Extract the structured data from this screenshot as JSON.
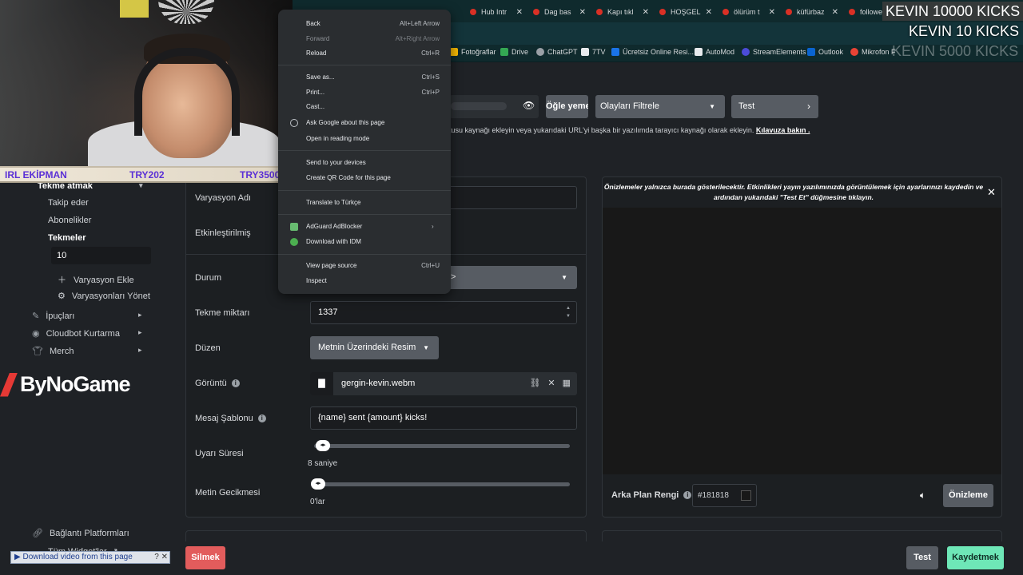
{
  "tabs": [
    {
      "label": "Hub Intr"
    },
    {
      "label": "Dag bas"
    },
    {
      "label": "Kapı tıkl"
    },
    {
      "label": "HOŞGEL"
    },
    {
      "label": "ölürüm t"
    },
    {
      "label": "küfürbaz"
    },
    {
      "label": "followe"
    }
  ],
  "bookmarks": [
    {
      "label": "Fotoğraflar",
      "color": "#fbbc04"
    },
    {
      "label": "Drive",
      "color": "#34a853"
    },
    {
      "label": "ChatGPT",
      "color": "#9aa0a6"
    },
    {
      "label": "7TV",
      "color": "#e8eaed"
    },
    {
      "label": "Ücretsiz Online Resi...",
      "color": "#1a73e8"
    },
    {
      "label": "AutoMod",
      "color": "#e8eaed"
    },
    {
      "label": "StreamElements",
      "color": "#4b4bd8"
    },
    {
      "label": "Outlook",
      "color": "#0a64d0"
    },
    {
      "label": "Mikrofon F",
      "color": "#ea4335"
    }
  ],
  "overlay": {
    "kicks1": "KEVIN  10000 KICKS",
    "kicks2": "KEVIN  10 KICKS",
    "kicks3": "KEVIN  5000 KICKS",
    "irl_label": "IRL EKİPMAN",
    "try1": "TRY202",
    "try2": "TRY35000"
  },
  "context_menu": {
    "back": "Back",
    "back_sc": "Alt+Left Arrow",
    "forward": "Forward",
    "forward_sc": "Alt+Right Arrow",
    "reload": "Reload",
    "reload_sc": "Ctrl+R",
    "save_as": "Save as...",
    "save_as_sc": "Ctrl+S",
    "print": "Print...",
    "print_sc": "Ctrl+P",
    "cast": "Cast...",
    "ask_google": "Ask Google about this page",
    "reading_mode": "Open in reading mode",
    "send_devices": "Send to your devices",
    "qr_code": "Create QR Code for this page",
    "translate": "Translate to Türkçe",
    "adguard": "AdGuard AdBlocker",
    "idm": "Download with IDM",
    "view_source": "View page source",
    "view_source_sc": "Ctrl+U",
    "inspect": "Inspect"
  },
  "sidebar": {
    "kick_event": "Tekme atmak",
    "follow": "Takip eder",
    "subs": "Abonelikler",
    "kicks": "Tekmeler",
    "kicks_value": "10",
    "add_variation": "Varyasyon Ekle",
    "manage_variations": "Varyasyonları Yönet",
    "tips": "İpuçları",
    "cloudbot": "Cloudbot Kurtarma",
    "merch": "Merch",
    "logo": "ByNoGame",
    "platforms": "Bağlantı Platformları",
    "all_widgets": "Tüm Widget'lar"
  },
  "topbar": {
    "lunch": "Öğle yemeği",
    "filter": "Olayları Filtrele",
    "test": "Test",
    "info": "tusu kaynağı ekleyin veya yukarıdaki URL'yi başka bir yazılımda tarayıcı kaynağı olarak ekleyin.",
    "guide": "Kılavuza bakın ."
  },
  "form": {
    "variation_name": "Varyasyon Adı",
    "enabled": "Etkinleştirilmiş",
    "status": "Durum",
    "status_value": ">",
    "kick_amount": "Tekme miktarı",
    "kick_amount_value": "1337",
    "layout": "Düzen",
    "layout_value": "Metnin Üzerindeki Resim",
    "image": "Görüntü",
    "image_file": "gergin-kevin.webm",
    "message_template": "Mesaj Şablonu",
    "message_template_value": "{name} sent {amount} kicks!",
    "alert_duration": "Uyarı Süresi",
    "alert_duration_value": "8 saniye",
    "alert_duration_level": 0.0,
    "text_delay": "Metin Gecikmesi",
    "text_delay_value": "0'lar",
    "text_delay_level": 0.0
  },
  "preview": {
    "message": "Önizlemeler yalnızca burada gösterilecektir. Etkinlikleri yayın yazılımınızda görüntülemek için ayarlarınızı kaydedin ve ardından yukarıdaki \"Test Et\" düğmesine tıklayın.",
    "bg_label": "Arka Plan Rengi",
    "bg_value": "#181818",
    "preview_button": "Önizleme"
  },
  "footer": {
    "delete": "Silmek",
    "test": "Test",
    "save": "Kaydetmek"
  },
  "idm_bar": "Download video from this page",
  "colors": {
    "accent_save": "#6ee7b7",
    "delete": "#e25c5c",
    "button": "#575c63",
    "background": "#1f2226"
  }
}
